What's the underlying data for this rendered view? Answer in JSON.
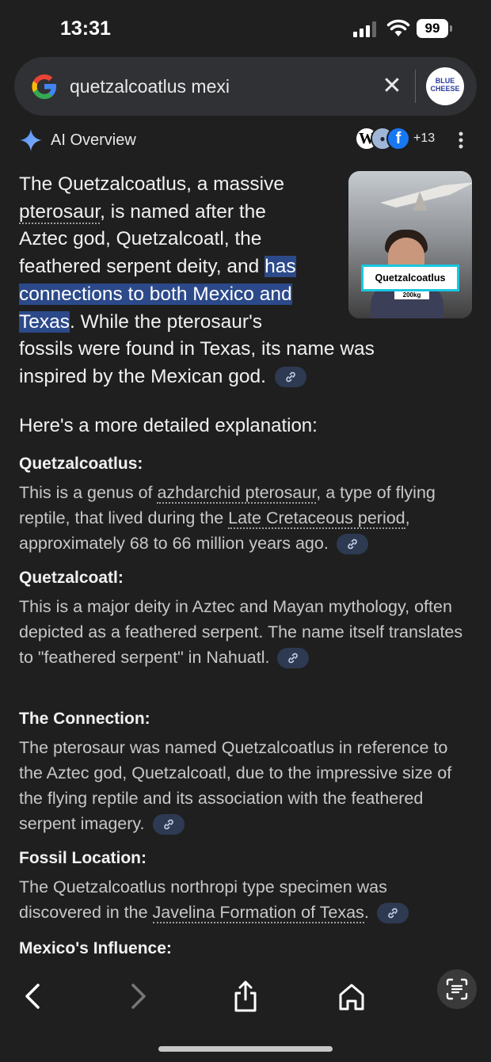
{
  "status": {
    "time": "13:31",
    "battery": "99"
  },
  "search": {
    "query": "quetzalcoatlus mexi",
    "clear_icon": "close-icon",
    "avatar_text": "BLUE CHEESE"
  },
  "ai": {
    "label": "AI Overview",
    "sources_more": "+13",
    "lead_before": "The Quetzalcoatlus, a massive ",
    "lead_link": "pterosaur",
    "lead_mid": ", is named after the Aztec god, Quetzalcoatl, the feathered serpent deity, and ",
    "lead_highlight": "has connections to both Mexico and Texas",
    "lead_after": ". While the pterosaur's fossils were found in Texas, its name was inspired by the Mexican god.",
    "thumb_caption": "Quetzalcoatlus",
    "thumb_sub": "200kg"
  },
  "detail_heading": "Here's a more detailed explanation:",
  "sections": [
    {
      "title": "Quetzalcoatlus:",
      "p1": "This is a genus of ",
      "link1": "azhdarchid pterosaur",
      "p2": ", a type of flying reptile, that lived during the ",
      "link2": "Late Cretaceous period",
      "p3": ", approximately 68 to 66 million years ago."
    },
    {
      "title": "Quetzalcoatl:",
      "text": "This is a major deity in Aztec and Mayan mythology, often depicted as a feathered serpent. The name itself translates to \"feathered serpent\" in Nahuatl."
    },
    {
      "title": "The Connection:",
      "text": "The pterosaur was named Quetzalcoatlus in reference to the Aztec god, Quetzalcoatl, due to the impressive size of the flying reptile and its association with the feathered serpent imagery."
    },
    {
      "title": "Fossil Location:",
      "p1": "The Quetzalcoatlus northropi type specimen was discovered in the ",
      "link1": "Javelina Formation of Texas",
      "p2": "."
    },
    {
      "title": "Mexico's Influence:"
    }
  ],
  "nav": [
    "back-icon",
    "forward-icon",
    "share-icon",
    "home-icon",
    "lens-icon"
  ]
}
